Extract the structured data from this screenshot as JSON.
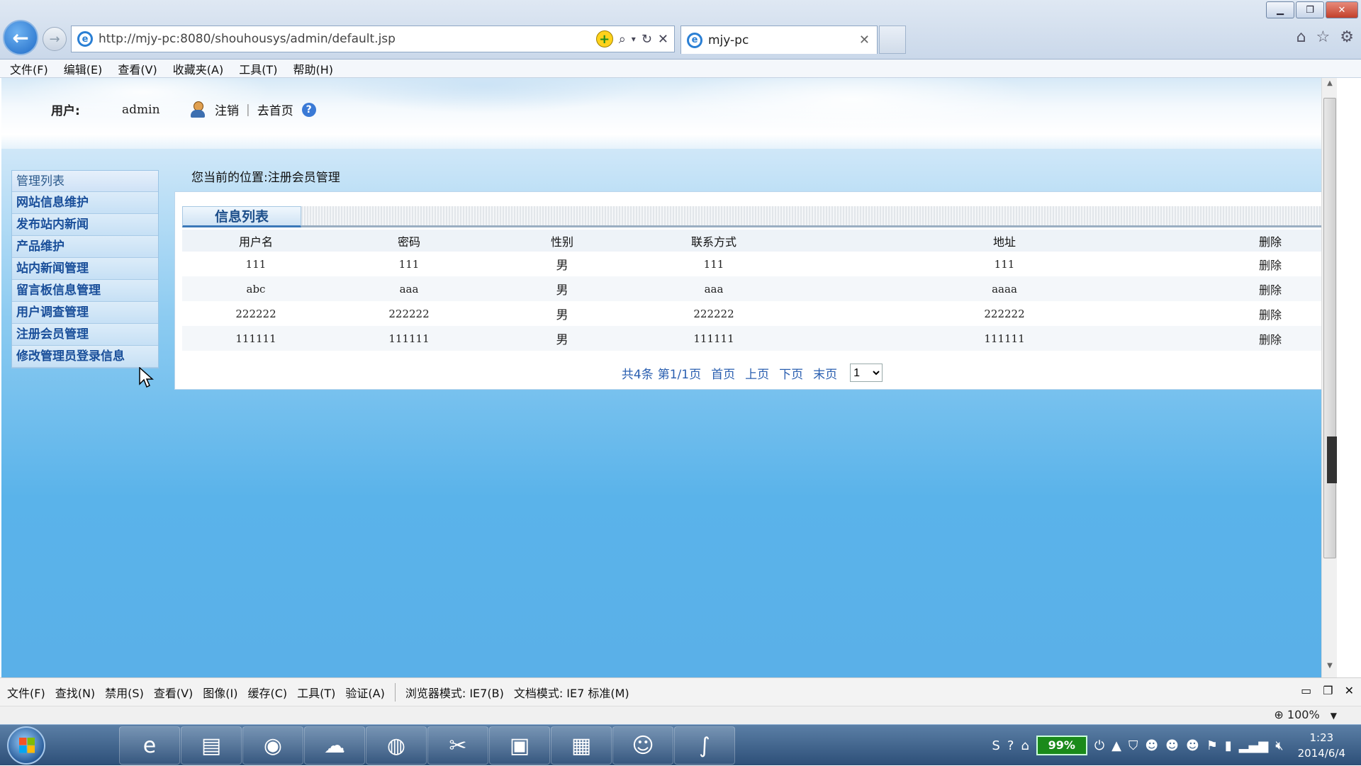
{
  "browser": {
    "url": "http://mjy-pc:8080/shouhousys/admin/default.jsp",
    "tab_title": "mjy-pc",
    "menu": [
      "文件(F)",
      "编辑(E)",
      "查看(V)",
      "收藏夹(A)",
      "工具(T)",
      "帮助(H)"
    ]
  },
  "header": {
    "user_label": "用户:",
    "user_name": "admin",
    "logout": "注销",
    "home": "去首页",
    "separator": "|"
  },
  "sidebar": {
    "title": "管理列表",
    "items": [
      {
        "label": "网站信息维护"
      },
      {
        "label": "发布站内新闻"
      },
      {
        "label": "产品维护"
      },
      {
        "label": "站内新闻管理"
      },
      {
        "label": "留言板信息管理"
      },
      {
        "label": "用户调查管理"
      },
      {
        "label": "注册会员管理"
      },
      {
        "label": "修改管理员登录信息"
      }
    ]
  },
  "breadcrumb": "您当前的位置:注册会员管理",
  "panel": {
    "tab_title": "信息列表",
    "columns": [
      "用户名",
      "密码",
      "性别",
      "联系方式",
      "地址",
      "删除"
    ],
    "rows": [
      {
        "username": "111",
        "password": "111",
        "sex": "男",
        "contact": "111",
        "address": "111",
        "delete": "删除"
      },
      {
        "username": "abc",
        "password": "aaa",
        "sex": "男",
        "contact": "aaa",
        "address": "aaaa",
        "delete": "删除"
      },
      {
        "username": "222222",
        "password": "222222",
        "sex": "男",
        "contact": "222222",
        "address": "222222",
        "delete": "删除"
      },
      {
        "username": "111111",
        "password": "111111",
        "sex": "男",
        "contact": "111111",
        "address": "111111",
        "delete": "删除"
      }
    ],
    "pager": {
      "total": "共4条",
      "page_info": "第1/1页",
      "first": "首页",
      "prev": "上页",
      "next": "下页",
      "last": "末页",
      "selected_page": "1"
    }
  },
  "devbar": {
    "items": [
      "文件(F)",
      "查找(N)",
      "禁用(S)",
      "查看(V)",
      "图像(I)",
      "缓存(C)",
      "工具(T)",
      "验证(A)"
    ],
    "browser_mode": "浏览器模式: IE7(B)",
    "doc_mode": "文档模式: IE7 标准(M)"
  },
  "status": {
    "zoom": "100%"
  },
  "taskbar": {
    "battery": "99%",
    "time": "1:23",
    "date": "2014/6/4"
  }
}
